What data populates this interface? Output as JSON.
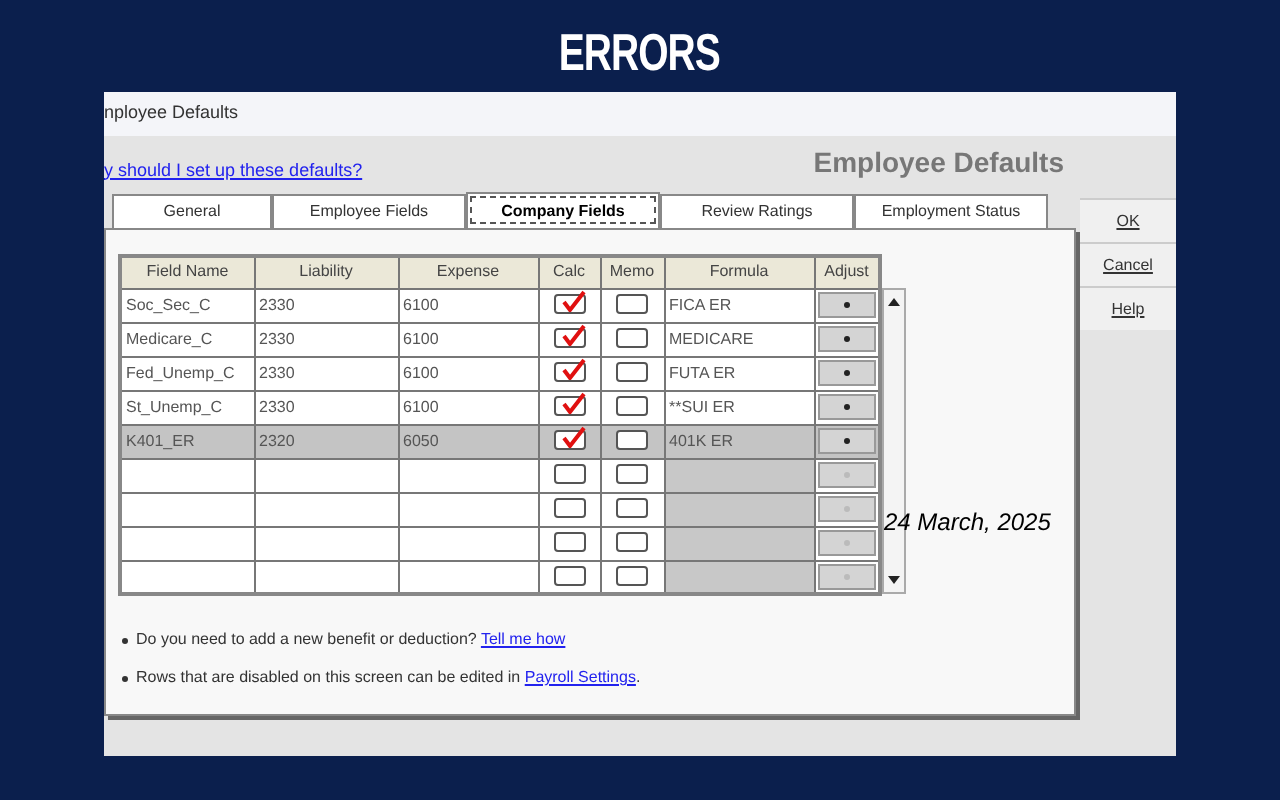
{
  "slide_title": "ERRORS",
  "date": "24 March, 2025",
  "window": {
    "title": "nployee Defaults"
  },
  "help_link": "y should I set up these defaults?",
  "heading": "Employee Defaults",
  "tabs": [
    {
      "label": "General",
      "selected": false
    },
    {
      "label": "Employee Fields",
      "selected": false
    },
    {
      "label": "Company Fields",
      "selected": true
    },
    {
      "label": "Review Ratings",
      "selected": false
    },
    {
      "label": "Employment Status",
      "selected": false
    }
  ],
  "table": {
    "columns": [
      "Field Name",
      "Liability",
      "Expense",
      "Calc",
      "Memo",
      "Formula",
      "Adjust"
    ],
    "rows": [
      {
        "field_name": "Soc_Sec_C",
        "liability": "2330",
        "expense": "6100",
        "calc": true,
        "memo": false,
        "formula": "FICA ER",
        "selected": false,
        "disabled": false
      },
      {
        "field_name": "Medicare_C",
        "liability": "2330",
        "expense": "6100",
        "calc": true,
        "memo": false,
        "formula": "MEDICARE",
        "selected": false,
        "disabled": false
      },
      {
        "field_name": "Fed_Unemp_C",
        "liability": "2330",
        "expense": "6100",
        "calc": true,
        "memo": false,
        "formula": "FUTA ER",
        "selected": false,
        "disabled": false
      },
      {
        "field_name": "St_Unemp_C",
        "liability": "2330",
        "expense": "6100",
        "calc": true,
        "memo": false,
        "formula": "**SUI ER",
        "selected": false,
        "disabled": false
      },
      {
        "field_name": "K401_ER",
        "liability": "2320",
        "expense": "6050",
        "calc": true,
        "memo": false,
        "formula": "401K ER",
        "selected": true,
        "disabled": false
      },
      {
        "calc": false,
        "memo": false,
        "selected": false,
        "disabled": true
      },
      {
        "calc": false,
        "memo": false,
        "selected": false,
        "disabled": true
      },
      {
        "calc": false,
        "memo": false,
        "selected": false,
        "disabled": true
      },
      {
        "calc": false,
        "memo": false,
        "selected": false,
        "disabled": true
      }
    ]
  },
  "buttons": [
    "OK",
    "Cancel",
    "Help"
  ],
  "notes": [
    {
      "text": "Do you need to add a new benefit or deduction?",
      "link": "Tell me how"
    },
    {
      "text": "Rows that are disabled on this screen can be edited in",
      "link": "Payroll Settings",
      "after": "."
    }
  ]
}
